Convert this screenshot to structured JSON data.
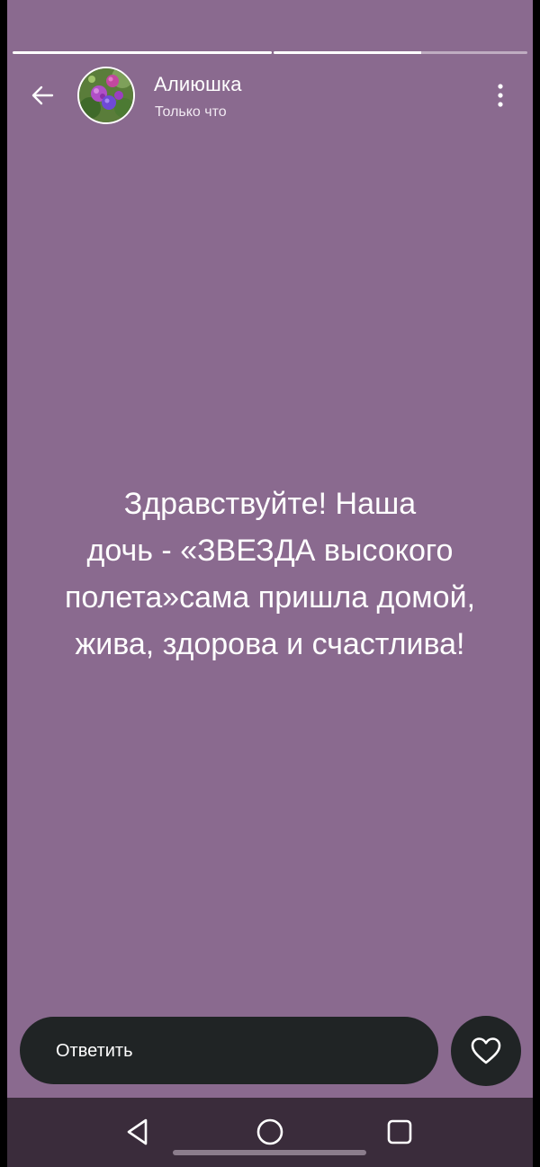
{
  "progress": [
    {
      "filled": 1.0
    },
    {
      "filled": 0.58
    }
  ],
  "header": {
    "author_name": "Алиюшка",
    "timestamp": "Только что",
    "back_icon": "arrow-left-icon",
    "menu_icon": "more-vertical-icon"
  },
  "story": {
    "background_color": "#8a6a8f",
    "text_lines": [
      "Здравствуйте! Наша",
      "дочь - «ЗВЕЗДА высокого",
      "полета»сама пришла домой,",
      "жива, здорова и счастлива!"
    ]
  },
  "footer": {
    "reply_label": "Ответить",
    "like_icon": "heart-icon"
  },
  "system_nav": {
    "back_icon": "triangle-back-icon",
    "home_icon": "circle-home-icon",
    "recent_icon": "square-recent-icon"
  }
}
